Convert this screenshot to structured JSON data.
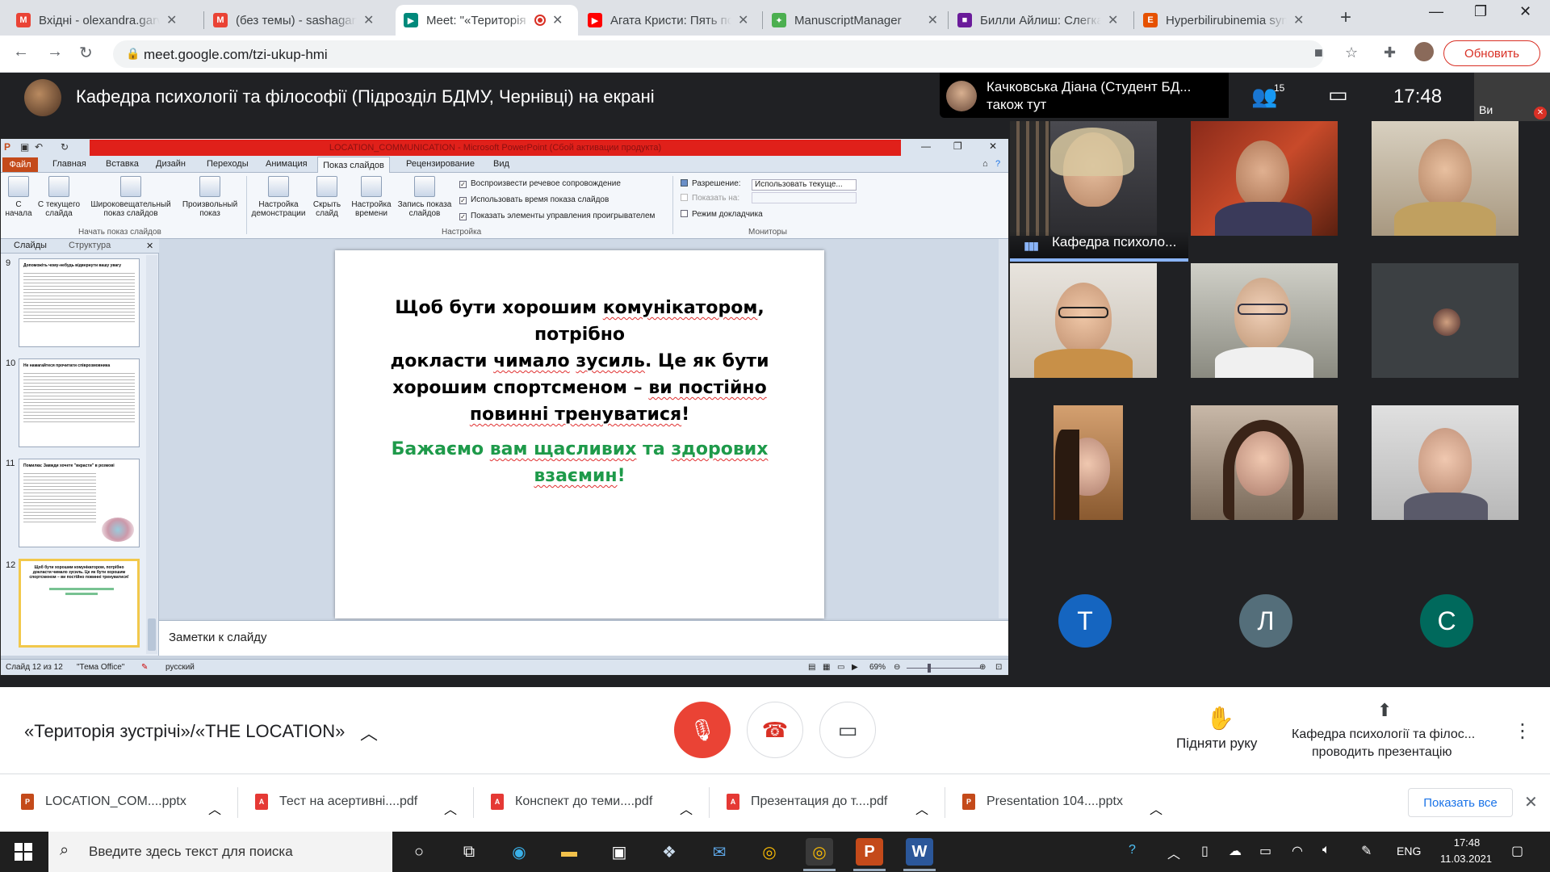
{
  "browser": {
    "tabs": [
      {
        "title": "Вхідні - olexandra.garvasiuk",
        "favicon": "gmail-icon",
        "color": "#ea4335"
      },
      {
        "title": "(без темы) - sashagarva",
        "favicon": "gmail-icon",
        "color": "#ea4335"
      },
      {
        "title": "Meet: \"«Територія зустрічі»",
        "favicon": "meet-icon",
        "color": "#00897b",
        "active": true
      },
      {
        "title": "Агата Кристи: Пять поросят",
        "favicon": "youtube-icon",
        "color": "#ff0000"
      },
      {
        "title": "ManuscriptManager",
        "favicon": "manuscript-icon",
        "color": "#4caf50"
      },
      {
        "title": "Билли Айлиш: Слегка размыто",
        "favicon": "film-icon",
        "color": "#6a1b9a"
      },
      {
        "title": "Hyperbilirubinemia syndrome",
        "favicon": "elsevier-icon",
        "color": "#e65100"
      }
    ],
    "url": "meet.google.com/tzi-ukup-hmi",
    "update_label": "Обновить"
  },
  "meet": {
    "presenting_title": "Кафедра психології та філософії (Підрозділ БДМУ, Чернівці) на екрані",
    "also_here_name": "Качковська Діана (Студент БД...",
    "also_here_sub": "також тут",
    "people_count": "15",
    "time": "17:48",
    "self_label": "Ви",
    "speaker_name": "Кафедра психоло...",
    "letter_tiles": [
      {
        "letter": "Т",
        "color": "#1565c0"
      },
      {
        "letter": "Л",
        "color": "#546e7a"
      },
      {
        "letter": "С",
        "color": "#00695c"
      }
    ],
    "meeting_name": "«Територія зустрічі»/«THE LOCATION»",
    "raise_hand_label": "Підняти руку",
    "presenter_name": "Кафедра психології та філос...",
    "presenter_sub": "проводить презентацію"
  },
  "ppt": {
    "window_title": "LOCATION_COMMUNICATION - Microsoft PowerPoint (Сбой активации продукта)",
    "tabs": [
      "Главная",
      "Вставка",
      "Дизайн",
      "Переходы",
      "Анимация",
      "Показ слайдов",
      "Рецензирование",
      "Вид"
    ],
    "file_tab": "Файл",
    "ribbon_buttons": [
      "С начала",
      "С текущего слайда",
      "Широковещательный показ слайдов",
      "Произвольный показ",
      "Настройка демонстрации",
      "Скрыть слайд",
      "Настройка времени",
      "Запись показа слайдов"
    ],
    "group_start": "Начать показ слайдов",
    "group_setup": "Настройка",
    "group_monitors": "Мониторы",
    "checks": [
      "Воспроизвести речевое сопровождение",
      "Использовать время показа слайдов",
      "Показать элементы управления проигрывателем"
    ],
    "resolution_label": "Разрешение:",
    "resolution_value": "Использовать текуще...",
    "show_on_label": "Показать на:",
    "presenter_mode": "Режим докладчика",
    "panel_tabs": [
      "Слайды",
      "Структура"
    ],
    "thumbs": [
      {
        "num": "9",
        "title": "Допоможіть чому-небудь відвернути вашу увагу"
      },
      {
        "num": "10",
        "title": "Не намагайтеся прочитати співрозмовника"
      },
      {
        "num": "11",
        "title": "Помилка: Завжди хочете \"вкрасти\" в розмові"
      },
      {
        "num": "12",
        "title": "Щоб бути хорошим комунікатором, потрібно докласти чимало зусиль. Це як бути хорошим спортсменом – ви постійно повинні тренуватися!"
      }
    ],
    "slide_line1_a": "Щоб бути хорошим ",
    "slide_line1_b": "комунікатором",
    "slide_line1_c": ", потрібно",
    "slide_line2_a": "докласти ",
    "slide_line2_b": "чимало",
    "slide_line2_c": " ",
    "slide_line2_d": "зусиль",
    "slide_line2_e": ". Це як бути",
    "slide_line3_a": "хорошим спортсменом – ",
    "slide_line3_b": "ви постійно",
    "slide_line4_a": "повинні тренуватися",
    "slide_line4_b": "!",
    "slide_green1_a": "Бажаємо ",
    "slide_green1_b": "вам щасливих",
    "slide_green1_c": " та ",
    "slide_green1_d": "здорових",
    "slide_green2_a": "взаємин",
    "slide_green2_b": "!",
    "notes_placeholder": "Заметки к слайду",
    "status_slide": "Слайд 12 из 12",
    "status_theme": "\"Тема Office\"",
    "status_lang": "русский",
    "zoom": "69%"
  },
  "downloads": [
    {
      "name": "LOCATION_COM....pptx",
      "type": "pptx"
    },
    {
      "name": "Тест на асертивні....pdf",
      "type": "pdf"
    },
    {
      "name": "Конспект до теми....pdf",
      "type": "pdf"
    },
    {
      "name": "Презентация до т....pdf",
      "type": "pdf"
    },
    {
      "name": "Presentation 104....pptx",
      "type": "pptx"
    }
  ],
  "show_all_label": "Показать все",
  "taskbar": {
    "search_placeholder": "Введите здесь текст для поиска",
    "lang": "ENG",
    "time": "17:48",
    "date": "11.03.2021"
  }
}
